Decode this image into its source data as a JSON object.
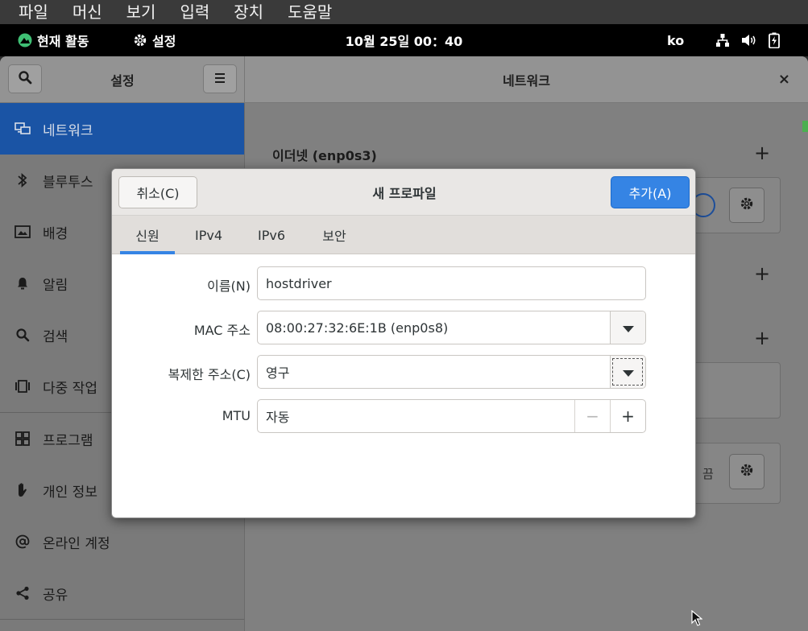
{
  "vbox_menu": [
    "파일",
    "머신",
    "보기",
    "입력",
    "장치",
    "도움말"
  ],
  "topbar": {
    "activities": "현재 활동",
    "app_menu": "설정",
    "clock": "10월 25일 00：40",
    "lang": "ko"
  },
  "window": {
    "left_title": "설정",
    "right_title": "네트워크",
    "close": "×"
  },
  "sidebar": {
    "items": [
      {
        "label": "네트워크",
        "icon": "network-icon",
        "active": true
      },
      {
        "label": "블루투스",
        "icon": "bluetooth-icon"
      },
      {
        "label": "배경",
        "icon": "background-icon"
      },
      {
        "label": "알림",
        "icon": "bell-icon"
      },
      {
        "label": "검색",
        "icon": "search-icon"
      },
      {
        "label": "다중 작업",
        "icon": "multitasking-icon"
      },
      {
        "label": "프로그램",
        "icon": "apps-icon"
      },
      {
        "label": "개인 정보",
        "icon": "privacy-hand-icon"
      },
      {
        "label": "온라인 계정",
        "icon": "at-icon"
      },
      {
        "label": "공유",
        "icon": "share-icon"
      }
    ]
  },
  "content": {
    "ethernet_title": "이더넷 (enp0s3)",
    "plus": "+",
    "off_label": "끔"
  },
  "dialog": {
    "cancel": "취소(C)",
    "title": "새 프로파일",
    "add": "추가(A)",
    "tabs": [
      "신원",
      "IPv4",
      "IPv6",
      "보안"
    ],
    "fields": {
      "name_label": "이름(N)",
      "name_value": "hostdriver",
      "mac_label": "MAC 주소",
      "mac_value": "08:00:27:32:6E:1B (enp0s8)",
      "cloned_label": "복제한 주소(C)",
      "cloned_value": "영구",
      "mtu_label": "MTU",
      "mtu_value": "자동",
      "minus": "−",
      "plus": "+"
    }
  },
  "colors": {
    "accent": "#3584e4",
    "sidebar_active": "#1a54a5"
  }
}
